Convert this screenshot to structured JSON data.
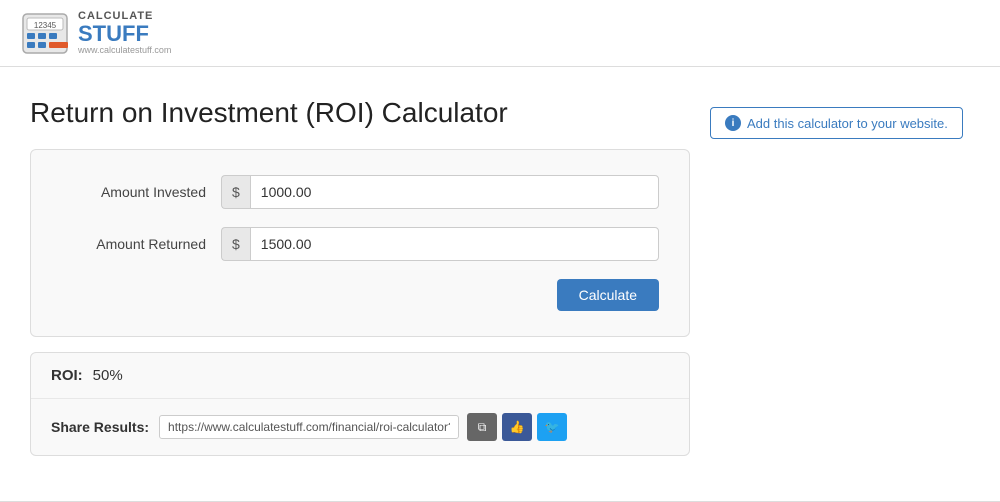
{
  "header": {
    "logo_calc": "CALCULATE",
    "logo_stuff": "STUFF",
    "logo_url": "www.calculatestuff.com"
  },
  "page": {
    "title": "Return on Investment (ROI) Calculator"
  },
  "calculator": {
    "amount_invested_label": "Amount Invested",
    "amount_returned_label": "Amount Returned",
    "amount_invested_value": "1000.00",
    "amount_returned_value": "1500.00",
    "currency_symbol": "$",
    "calculate_button": "Calculate"
  },
  "results": {
    "roi_label": "ROI:",
    "roi_value": "50%",
    "share_label": "Share Results:",
    "share_url": "https://www.calculatestuff.com/financial/roi-calculator?amount_investe"
  },
  "sidebar": {
    "add_widget_label": "Add this calculator to your website."
  },
  "icons": {
    "info": "i",
    "copy": "⧉",
    "thumbs_up": "👍",
    "twitter": "🐦"
  }
}
